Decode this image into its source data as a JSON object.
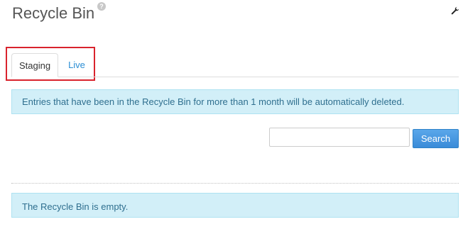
{
  "page": {
    "title": "Recycle Bin",
    "help_glyph": "?"
  },
  "tabs": [
    {
      "label": "Staging",
      "active": true
    },
    {
      "label": "Live",
      "active": false
    }
  ],
  "notices": {
    "retention": "Entries that have been in the Recycle Bin for more than 1 month will be automatically deleted.",
    "empty": "The Recycle Bin is empty."
  },
  "search": {
    "value": "",
    "placeholder": "",
    "button_label": "Search"
  },
  "colors": {
    "accent": "#2a8dd4",
    "alert_background": "#d2eff8",
    "alert_text": "#2f6f8f",
    "highlight": "#d9232d"
  },
  "icons": {
    "help": "help-icon",
    "config": "wrench-icon"
  }
}
